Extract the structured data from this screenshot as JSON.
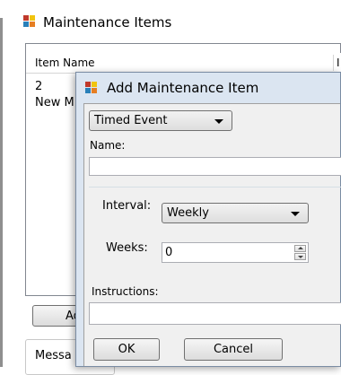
{
  "back_window": {
    "title": "Maintenance Items",
    "column_headers": [
      "Item Name",
      "I"
    ],
    "rows": [
      {
        "name": "2"
      },
      {
        "name": "New M"
      }
    ],
    "add_button_label": "Ad",
    "message_label": "Messa"
  },
  "dialog": {
    "title": "Add Maintenance Item",
    "type_combo": {
      "selected": "Timed Event"
    },
    "name_label": "Name:",
    "name_value": "",
    "interval_label": "Interval:",
    "interval_combo": {
      "selected": "Weekly"
    },
    "weeks_label": "Weeks:",
    "weeks_value": "0",
    "instructions_label": "Instructions:",
    "instructions_value": "",
    "ok_label": "OK",
    "cancel_label": "Cancel"
  },
  "colors": {
    "background": "#ffffff",
    "dialog_bg": "#f0f0f0",
    "border": "#707070"
  }
}
